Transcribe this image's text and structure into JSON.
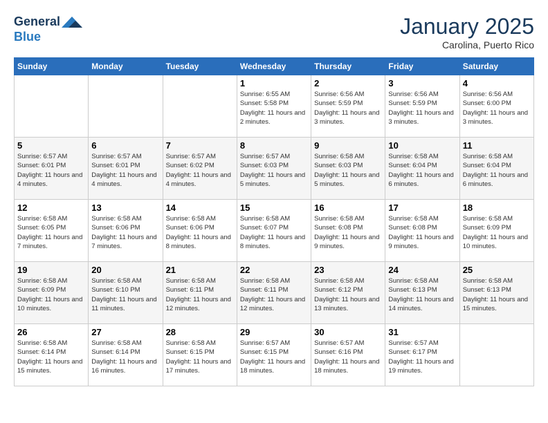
{
  "logo": {
    "line1": "General",
    "line2": "Blue"
  },
  "title": "January 2025",
  "subtitle": "Carolina, Puerto Rico",
  "days_of_week": [
    "Sunday",
    "Monday",
    "Tuesday",
    "Wednesday",
    "Thursday",
    "Friday",
    "Saturday"
  ],
  "weeks": [
    [
      {
        "day": "",
        "info": ""
      },
      {
        "day": "",
        "info": ""
      },
      {
        "day": "",
        "info": ""
      },
      {
        "day": "1",
        "info": "Sunrise: 6:55 AM\nSunset: 5:58 PM\nDaylight: 11 hours and 2 minutes."
      },
      {
        "day": "2",
        "info": "Sunrise: 6:56 AM\nSunset: 5:59 PM\nDaylight: 11 hours and 3 minutes."
      },
      {
        "day": "3",
        "info": "Sunrise: 6:56 AM\nSunset: 5:59 PM\nDaylight: 11 hours and 3 minutes."
      },
      {
        "day": "4",
        "info": "Sunrise: 6:56 AM\nSunset: 6:00 PM\nDaylight: 11 hours and 3 minutes."
      }
    ],
    [
      {
        "day": "5",
        "info": "Sunrise: 6:57 AM\nSunset: 6:01 PM\nDaylight: 11 hours and 4 minutes."
      },
      {
        "day": "6",
        "info": "Sunrise: 6:57 AM\nSunset: 6:01 PM\nDaylight: 11 hours and 4 minutes."
      },
      {
        "day": "7",
        "info": "Sunrise: 6:57 AM\nSunset: 6:02 PM\nDaylight: 11 hours and 4 minutes."
      },
      {
        "day": "8",
        "info": "Sunrise: 6:57 AM\nSunset: 6:03 PM\nDaylight: 11 hours and 5 minutes."
      },
      {
        "day": "9",
        "info": "Sunrise: 6:58 AM\nSunset: 6:03 PM\nDaylight: 11 hours and 5 minutes."
      },
      {
        "day": "10",
        "info": "Sunrise: 6:58 AM\nSunset: 6:04 PM\nDaylight: 11 hours and 6 minutes."
      },
      {
        "day": "11",
        "info": "Sunrise: 6:58 AM\nSunset: 6:04 PM\nDaylight: 11 hours and 6 minutes."
      }
    ],
    [
      {
        "day": "12",
        "info": "Sunrise: 6:58 AM\nSunset: 6:05 PM\nDaylight: 11 hours and 7 minutes."
      },
      {
        "day": "13",
        "info": "Sunrise: 6:58 AM\nSunset: 6:06 PM\nDaylight: 11 hours and 7 minutes."
      },
      {
        "day": "14",
        "info": "Sunrise: 6:58 AM\nSunset: 6:06 PM\nDaylight: 11 hours and 8 minutes."
      },
      {
        "day": "15",
        "info": "Sunrise: 6:58 AM\nSunset: 6:07 PM\nDaylight: 11 hours and 8 minutes."
      },
      {
        "day": "16",
        "info": "Sunrise: 6:58 AM\nSunset: 6:08 PM\nDaylight: 11 hours and 9 minutes."
      },
      {
        "day": "17",
        "info": "Sunrise: 6:58 AM\nSunset: 6:08 PM\nDaylight: 11 hours and 9 minutes."
      },
      {
        "day": "18",
        "info": "Sunrise: 6:58 AM\nSunset: 6:09 PM\nDaylight: 11 hours and 10 minutes."
      }
    ],
    [
      {
        "day": "19",
        "info": "Sunrise: 6:58 AM\nSunset: 6:09 PM\nDaylight: 11 hours and 10 minutes."
      },
      {
        "day": "20",
        "info": "Sunrise: 6:58 AM\nSunset: 6:10 PM\nDaylight: 11 hours and 11 minutes."
      },
      {
        "day": "21",
        "info": "Sunrise: 6:58 AM\nSunset: 6:11 PM\nDaylight: 11 hours and 12 minutes."
      },
      {
        "day": "22",
        "info": "Sunrise: 6:58 AM\nSunset: 6:11 PM\nDaylight: 11 hours and 12 minutes."
      },
      {
        "day": "23",
        "info": "Sunrise: 6:58 AM\nSunset: 6:12 PM\nDaylight: 11 hours and 13 minutes."
      },
      {
        "day": "24",
        "info": "Sunrise: 6:58 AM\nSunset: 6:13 PM\nDaylight: 11 hours and 14 minutes."
      },
      {
        "day": "25",
        "info": "Sunrise: 6:58 AM\nSunset: 6:13 PM\nDaylight: 11 hours and 15 minutes."
      }
    ],
    [
      {
        "day": "26",
        "info": "Sunrise: 6:58 AM\nSunset: 6:14 PM\nDaylight: 11 hours and 15 minutes."
      },
      {
        "day": "27",
        "info": "Sunrise: 6:58 AM\nSunset: 6:14 PM\nDaylight: 11 hours and 16 minutes."
      },
      {
        "day": "28",
        "info": "Sunrise: 6:58 AM\nSunset: 6:15 PM\nDaylight: 11 hours and 17 minutes."
      },
      {
        "day": "29",
        "info": "Sunrise: 6:57 AM\nSunset: 6:15 PM\nDaylight: 11 hours and 18 minutes."
      },
      {
        "day": "30",
        "info": "Sunrise: 6:57 AM\nSunset: 6:16 PM\nDaylight: 11 hours and 18 minutes."
      },
      {
        "day": "31",
        "info": "Sunrise: 6:57 AM\nSunset: 6:17 PM\nDaylight: 11 hours and 19 minutes."
      },
      {
        "day": "",
        "info": ""
      }
    ]
  ]
}
